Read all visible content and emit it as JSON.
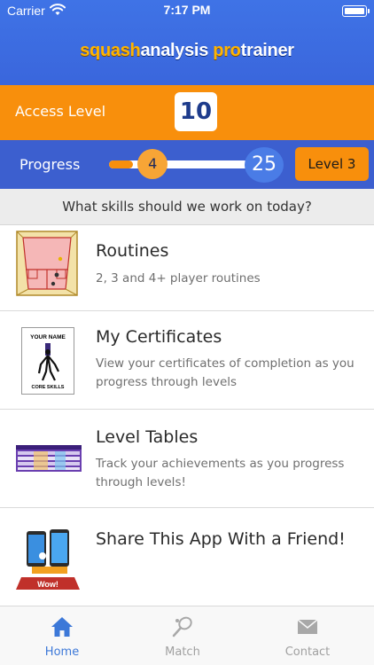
{
  "status_bar": {
    "carrier": "Carrier",
    "time": "7:17 PM"
  },
  "logo": {
    "part1": "squash",
    "part2": "analysis ",
    "part3": "pro",
    "part4": "trainer"
  },
  "access": {
    "label": "Access Level",
    "value": "10"
  },
  "progress": {
    "label": "Progress",
    "current": "4",
    "max": "25",
    "current_value": 4,
    "max_value": 25,
    "level": "Level 3"
  },
  "prompt": "What skills should we work on today?",
  "items": [
    {
      "title": "Routines",
      "desc": "2, 3 and 4+ player routines",
      "icon": "court-diagram-icon"
    },
    {
      "title": "My Certificates",
      "desc": "View your certificates of completion as you progress through levels",
      "icon": "certificate-icon",
      "cert_name": "YOUR NAME",
      "cert_sub": "CORE SKILLS"
    },
    {
      "title": "Level Tables",
      "desc": "Track your achievements as you progress through levels!",
      "icon": "level-table-icon"
    },
    {
      "title": "Share This App With a Friend!",
      "desc": "",
      "icon": "share-phones-icon",
      "badge": "Wow!"
    }
  ],
  "tabs": [
    {
      "label": "Home",
      "icon": "home-icon",
      "active": true
    },
    {
      "label": "Match",
      "icon": "racket-icon",
      "active": false
    },
    {
      "label": "Contact",
      "icon": "mail-icon",
      "active": false
    }
  ],
  "colors": {
    "header_blue": "#3f73e6",
    "orange": "#f88f0c",
    "progress_blue": "#3c5fcf",
    "tab_active": "#3c78d8"
  }
}
